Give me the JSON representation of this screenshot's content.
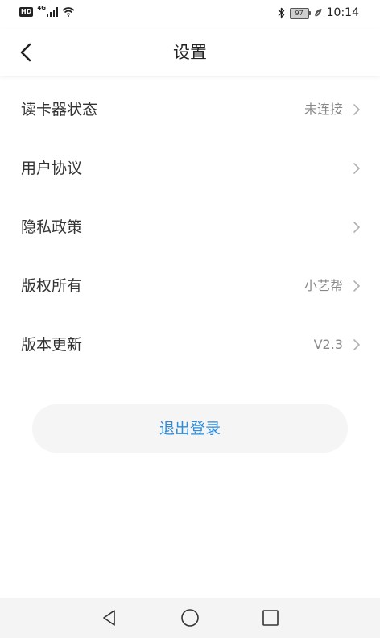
{
  "status_bar": {
    "hd_label": "HD",
    "network_label": "4G",
    "battery_level": "97",
    "time": "10:14"
  },
  "header": {
    "title": "设置"
  },
  "settings": {
    "items": [
      {
        "label": "读卡器状态",
        "value": "未连接"
      },
      {
        "label": "用户协议",
        "value": ""
      },
      {
        "label": "隐私政策",
        "value": ""
      },
      {
        "label": "版权所有",
        "value": "小艺帮"
      },
      {
        "label": "版本更新",
        "value": "V2.3"
      }
    ]
  },
  "logout": {
    "label": "退出登录"
  },
  "colors": {
    "accent": "#2c8ddc",
    "label_text": "#333333",
    "value_text": "#888888",
    "chevron": "#b0b0b0",
    "logout_bg": "#f5f5f5",
    "nav_bg": "#f4f4f4"
  },
  "icons": {
    "back": "chevron-left-icon",
    "row_arrow": "chevron-right-icon",
    "nav_back": "triangle-back-icon",
    "nav_home": "circle-home-icon",
    "nav_recent": "square-recent-icon"
  }
}
